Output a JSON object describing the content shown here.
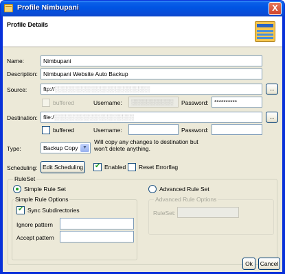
{
  "window": {
    "title": "Profile Nimbupani",
    "close_label": "X"
  },
  "header": {
    "title": "Profile Details"
  },
  "form": {
    "name_label": "Name:",
    "name_value": "Nimbupani",
    "description_label": "Description:",
    "description_value": "Nimbupani Website Auto Backup",
    "source_label": "Source:",
    "source_value": "ftp://",
    "source_value_obscured": "░░░░░░░░░░░░░░░░░░░░░░░░░",
    "source_browse_label": "...",
    "source_buffered_label": "buffered",
    "source_username_label": "Username:",
    "source_username_obscured": "░░░░░░░░░░░",
    "source_password_label": "Password:",
    "source_password_value": "**********",
    "destination_label": "Destination:",
    "destination_value": "file:/",
    "destination_value_obscured": "░░░░░░░░░░░░░░░░░░░░░",
    "destination_browse_label": "...",
    "destination_buffered_label": "buffered",
    "destination_username_label": "Username:",
    "destination_username_value": "",
    "destination_password_label": "Password:",
    "destination_password_value": "",
    "type_label": "Type:",
    "type_value": "Backup Copy",
    "type_description_line1": "Will copy any changes to destination but",
    "type_description_line2": "won't delete anything.",
    "scheduling_label": "Scheduling:",
    "edit_scheduling_label": "Edit Scheduling",
    "enabled_label": "Enabled",
    "enabled_checked": true,
    "reset_errorflag_label": "Reset Errorflag",
    "reset_errorflag_checked": false
  },
  "ruleset": {
    "legend": "RuleSet",
    "simple_label": "Simple Rule Set",
    "simple_selected": true,
    "advanced_label": "Advanced Rule Set",
    "simple_options": {
      "legend": "Simple Rule Options",
      "sync_subdirs_label": "Sync Subdirectories",
      "sync_subdirs_checked": true,
      "ignore_label": "Ignore pattern",
      "ignore_value": "",
      "accept_label": "Accept pattern",
      "accept_value": ""
    },
    "advanced_options": {
      "legend": "Advanced Rule Options",
      "ruleset_label": "RuleSet:",
      "ruleset_value": ""
    }
  },
  "buttons": {
    "ok_label": "Ok",
    "cancel_label": "Cancel"
  },
  "colors": {
    "title_bar": "#0054e3",
    "dialog_bg": "#ece9d8",
    "check_green": "#21a121"
  },
  "icons": {
    "title": "profile-window-icon",
    "header": "profile-details-icon",
    "close": "close-icon"
  }
}
